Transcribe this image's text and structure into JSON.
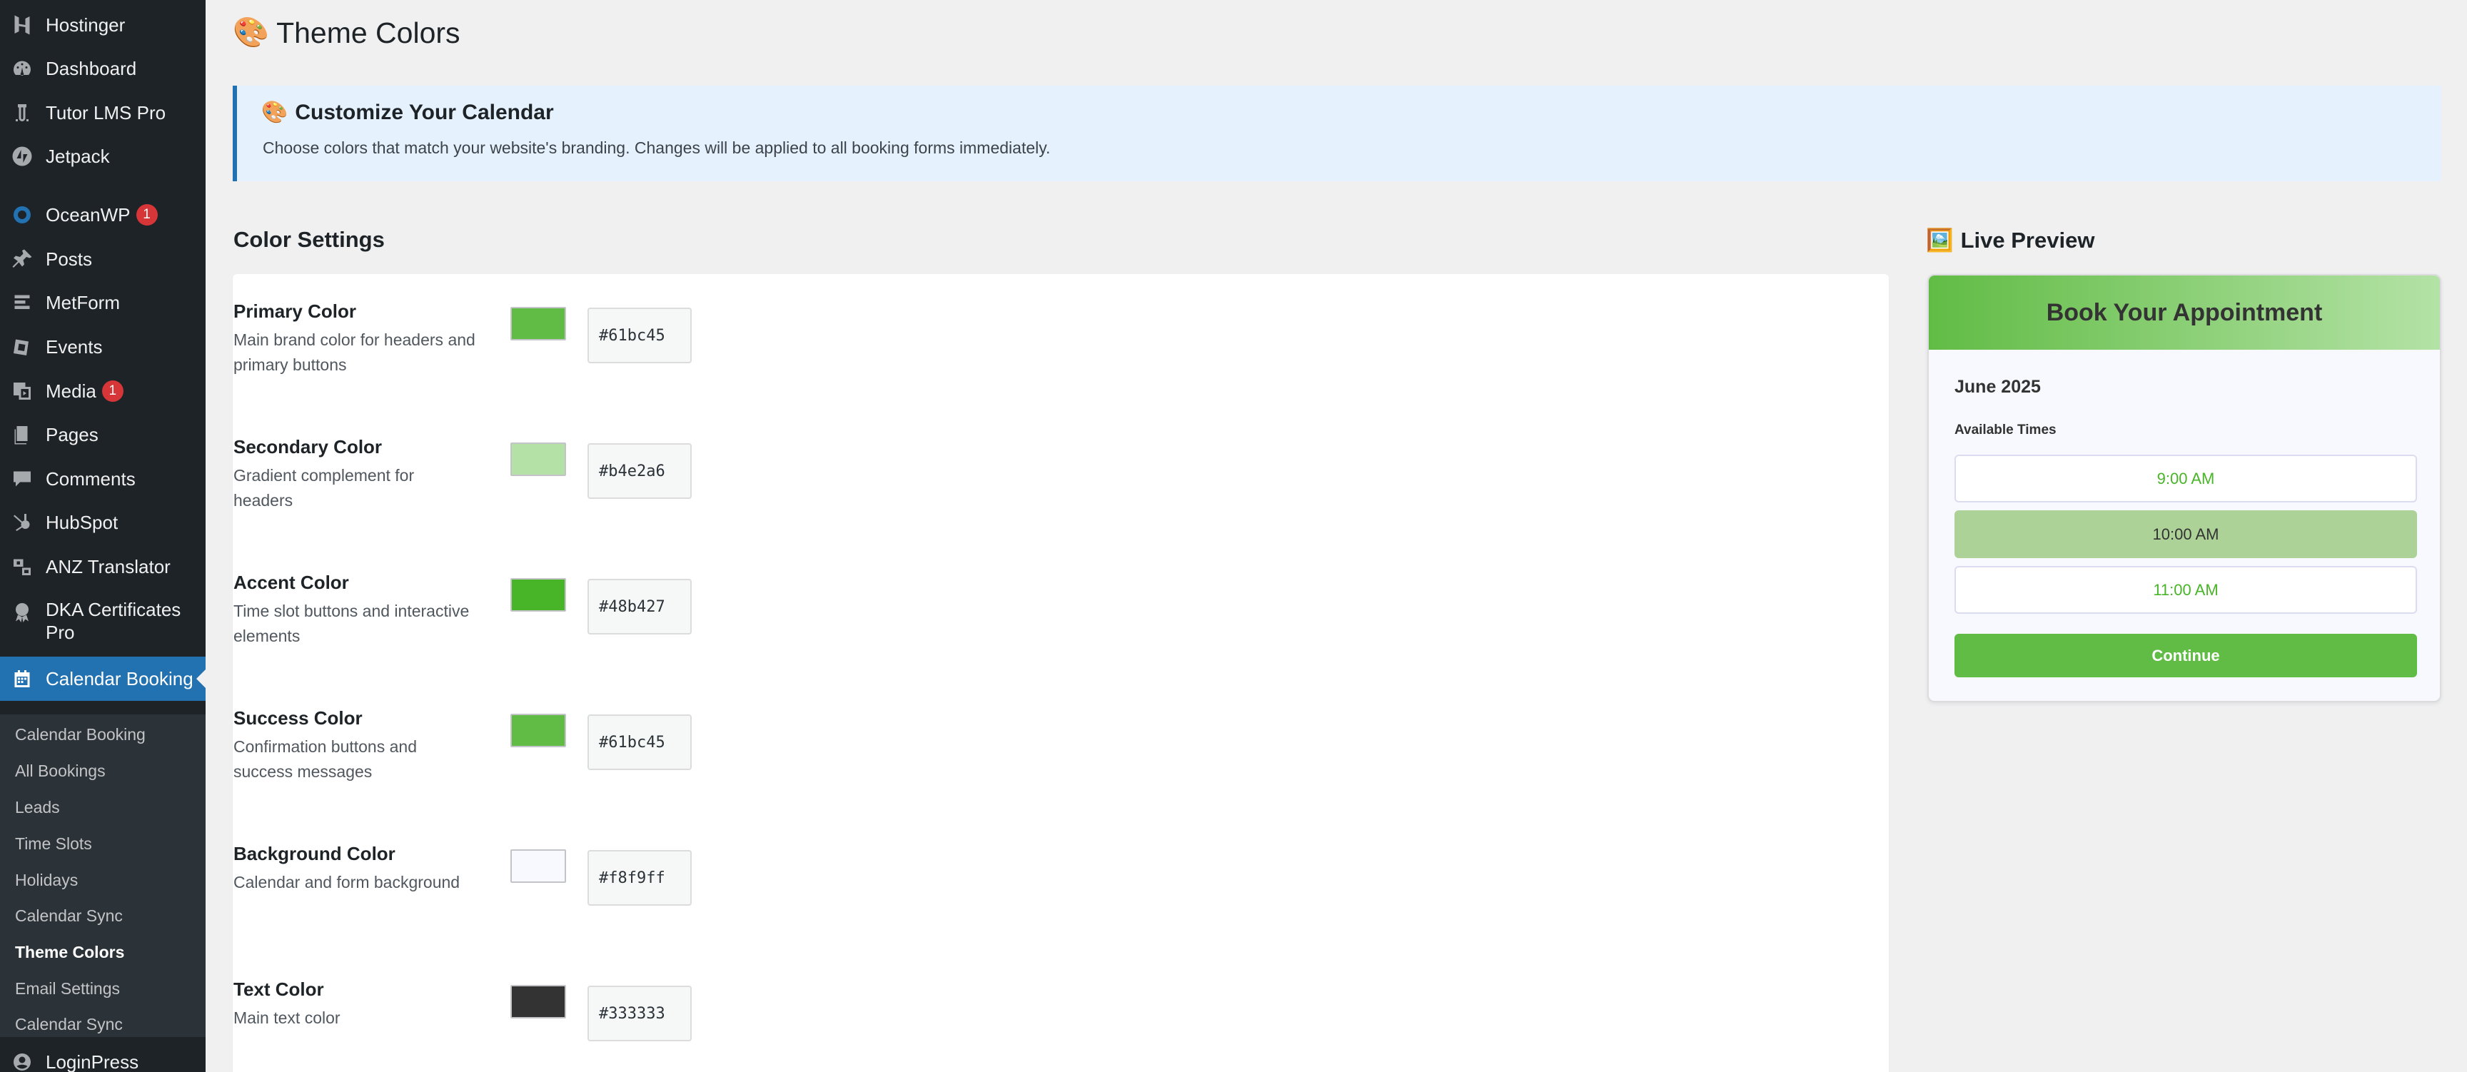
{
  "sidebar": {
    "items": [
      {
        "label": "Hostinger",
        "icon": "hostinger-icon"
      },
      {
        "label": "Dashboard",
        "icon": "dashboard-icon"
      },
      {
        "label": "Tutor LMS Pro",
        "icon": "tutor-icon"
      },
      {
        "label": "Jetpack",
        "icon": "jetpack-icon"
      },
      {
        "label": "OceanWP",
        "icon": "oceanwp-icon",
        "badge": "1"
      },
      {
        "label": "Posts",
        "icon": "pin-icon"
      },
      {
        "label": "MetForm",
        "icon": "metform-icon"
      },
      {
        "label": "Events",
        "icon": "events-icon"
      },
      {
        "label": "Media",
        "icon": "media-icon",
        "badge": "1"
      },
      {
        "label": "Pages",
        "icon": "pages-icon"
      },
      {
        "label": "Comments",
        "icon": "comments-icon"
      },
      {
        "label": "HubSpot",
        "icon": "hubspot-icon"
      },
      {
        "label": "ANZ Translator",
        "icon": "translate-icon"
      },
      {
        "label": "DKA Certificates Pro",
        "icon": "certificate-icon"
      },
      {
        "label": "Calendar Booking",
        "icon": "calendar-icon"
      },
      {
        "label": "LoginPress",
        "icon": "loginpress-icon"
      }
    ],
    "submenu": [
      "Calendar Booking",
      "All Bookings",
      "Leads",
      "Time Slots",
      "Holidays",
      "Calendar Sync",
      "Theme Colors",
      "Email Settings",
      "Calendar Sync"
    ]
  },
  "page": {
    "title_emoji": "🎨",
    "title": "Theme Colors"
  },
  "notice": {
    "title_emoji": "🎨",
    "title": "Customize Your Calendar",
    "text": "Choose colors that match your website's branding. Changes will be applied to all booking forms immediately."
  },
  "settings": {
    "heading": "Color Settings",
    "colors": [
      {
        "label": "Primary Color",
        "description": "Main brand color for headers and primary buttons",
        "value": "#61bc45"
      },
      {
        "label": "Secondary Color",
        "description": "Gradient complement for headers",
        "value": "#b4e2a6"
      },
      {
        "label": "Accent Color",
        "description": "Time slot buttons and interactive elements",
        "value": "#48b427"
      },
      {
        "label": "Success Color",
        "description": "Confirmation buttons and success messages",
        "value": "#61bc45"
      },
      {
        "label": "Background Color",
        "description": "Calendar and form background",
        "value": "#f8f9ff"
      },
      {
        "label": "Text Color",
        "description": "Main text color",
        "value": "#333333"
      }
    ]
  },
  "preview": {
    "heading_emoji": "🖼️",
    "heading": "Live Preview",
    "card_title": "Book Your Appointment",
    "month": "June 2025",
    "available_label": "Available Times",
    "slots": [
      "9:00 AM",
      "10:00 AM",
      "11:00 AM"
    ],
    "selected_slot": "10:00 AM",
    "continue_label": "Continue"
  },
  "colors": {
    "sidebar_bg": "#1d2327",
    "active_menu": "#2271b1",
    "badge": "#d63638",
    "selected_slot_bg": "#acd297"
  }
}
